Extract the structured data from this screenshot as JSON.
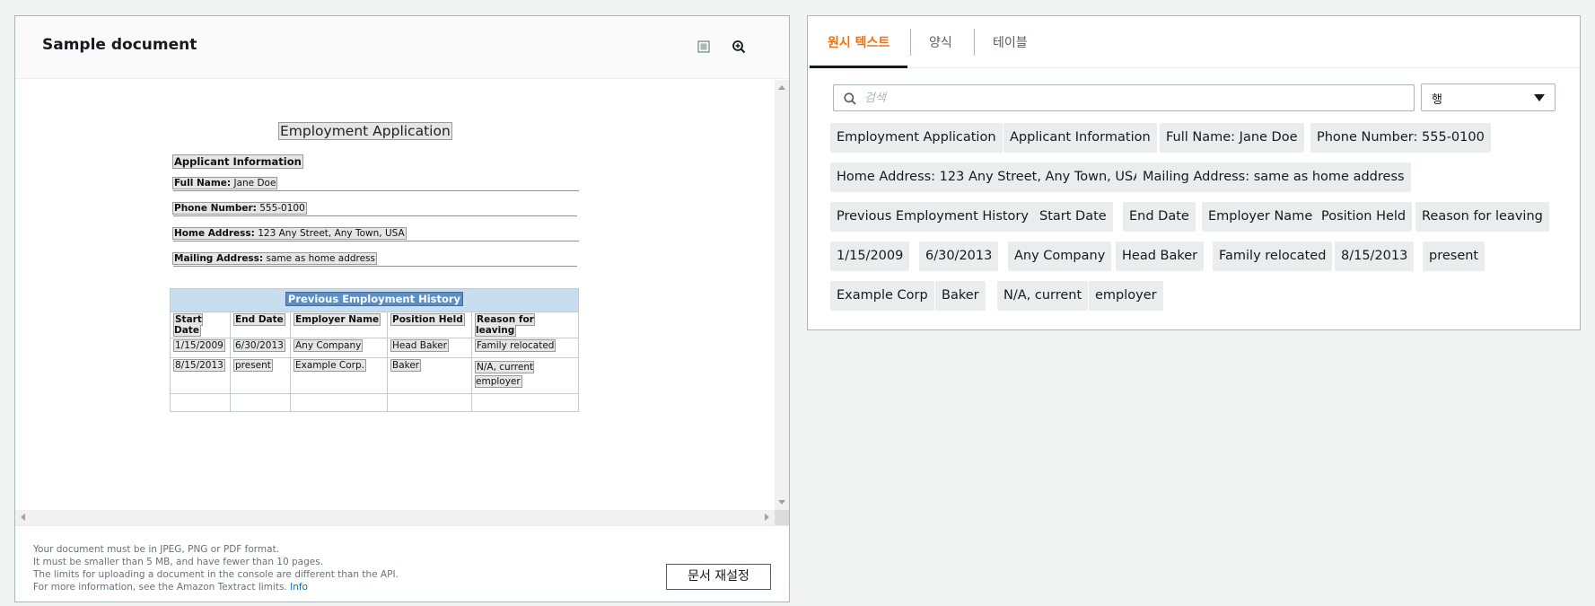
{
  "left_panel": {
    "title": "Sample document",
    "view_icon": "layout-icon",
    "zoom_icon": "zoom-in-icon",
    "document": {
      "title": "Employment Application",
      "section": "Applicant Information",
      "fields": [
        {
          "label": "Full Name:",
          "value": "Jane Doe"
        },
        {
          "label": "Phone Number:",
          "value": "555-0100"
        },
        {
          "label": "Home Address:",
          "value": "123 Any Street, Any Town, USA"
        },
        {
          "label": "Mailing Address:",
          "value": " same as home address"
        }
      ],
      "table": {
        "caption": "Previous Employment History",
        "headers": [
          "Start Date",
          "End Date",
          "Employer Name",
          "Position Held",
          "Reason for leaving"
        ],
        "rows": [
          [
            "1/15/2009",
            "6/30/2013",
            "Any Company",
            "Head Baker",
            "Family relocated"
          ],
          [
            "8/15/2013",
            "present",
            "Example Corp.",
            "Baker",
            "N/A, current employer"
          ]
        ]
      }
    },
    "footer": {
      "line1": "Your document must be in JPEG, PNG or PDF format.",
      "line2": "It must be smaller than 5 MB, and have fewer than 10 pages.",
      "line3": "The limits for uploading a document in the console are different than the API.",
      "line4": "For more information, see the Amazon Textract limits.",
      "info_link": "Info",
      "reset_button": "문서 재설정"
    }
  },
  "right_panel": {
    "tabs": [
      "원시 텍스트",
      "양식",
      "테이블"
    ],
    "active_tab": 0,
    "search": {
      "placeholder": "검색",
      "value": ""
    },
    "select": {
      "value": "행"
    },
    "chip_rows": [
      [
        "Employment Application",
        "Applicant Information",
        "Full Name: Jane Doe",
        "Phone Number: 555-0100"
      ],
      [
        "Home Address: 123 Any Street, Any Town, USA",
        "Mailing Address: same as home address"
      ],
      [
        "Previous Employment History",
        "Start Date",
        "End Date",
        "Employer Name",
        "Position Held",
        "Reason for leaving"
      ],
      [
        "1/15/2009",
        "6/30/2013",
        "Any Company",
        "Head Baker",
        "Family relocated",
        "8/15/2013",
        "present"
      ],
      [
        "Example Corp",
        "Baker",
        "N/A, current",
        "employer"
      ]
    ]
  },
  "colors": {
    "accent": "#ec7211",
    "link": "#0073bb",
    "chip_bg": "#eaeded",
    "table_caption_bg": "#c9ddf0",
    "table_caption_highlight": "#5d8fc4"
  }
}
